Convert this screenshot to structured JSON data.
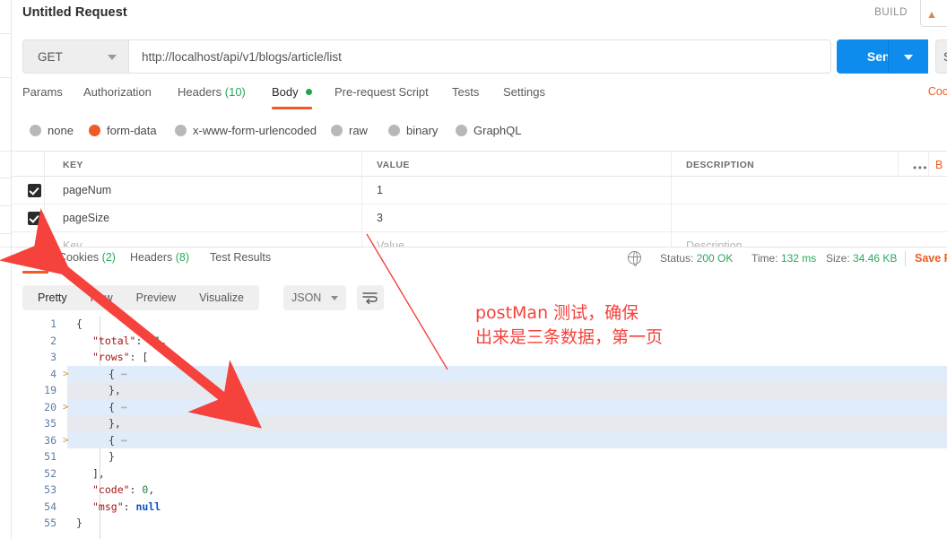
{
  "window": {
    "request_title": "Untitled Request",
    "build_label": "BUILD"
  },
  "url_bar": {
    "method": "GET",
    "url": "http://localhost/api/v1/blogs/article/list",
    "send_label": "Send",
    "save_label": "Sa"
  },
  "request_tabs": {
    "items": [
      {
        "label": "Params",
        "count": "",
        "active": false
      },
      {
        "label": "Authorization",
        "count": "",
        "active": false
      },
      {
        "label": "Headers",
        "count": "(10)",
        "active": false
      },
      {
        "label": "Body",
        "count": "",
        "active": true
      },
      {
        "label": "Pre-request Script",
        "count": "",
        "active": false
      },
      {
        "label": "Tests",
        "count": "",
        "active": false
      },
      {
        "label": "Settings",
        "count": "",
        "active": false
      }
    ],
    "cookies_link": "Cook"
  },
  "body_types": {
    "options": [
      {
        "label": "none",
        "selected": false
      },
      {
        "label": "form-data",
        "selected": true
      },
      {
        "label": "x-www-form-urlencoded",
        "selected": false
      },
      {
        "label": "raw",
        "selected": false
      },
      {
        "label": "binary",
        "selected": false
      },
      {
        "label": "GraphQL",
        "selected": false
      }
    ]
  },
  "kv_table": {
    "headers": {
      "key": "KEY",
      "value": "VALUE",
      "description": "DESCRIPTION"
    },
    "bulk_edit_label": "B",
    "rows": [
      {
        "checked": true,
        "key": "pageNum",
        "value": "1",
        "description": ""
      },
      {
        "checked": true,
        "key": "pageSize",
        "value": "3",
        "description": ""
      },
      {
        "checked": false,
        "key": "Key",
        "value": "Value",
        "description": "Description",
        "placeholder": true
      }
    ]
  },
  "response": {
    "tabs": [
      {
        "label": "Body",
        "count": "",
        "active": true
      },
      {
        "label": "Cookies",
        "count": "(2)",
        "active": false
      },
      {
        "label": "Headers",
        "count": "(8)",
        "active": false
      },
      {
        "label": "Test Results",
        "count": "",
        "active": false
      }
    ],
    "status_label": "Status:",
    "status_value": "200 OK",
    "time_label": "Time:",
    "time_value": "132 ms",
    "size_label": "Size:",
    "size_value": "34.46 KB",
    "save_response_label": "Save Res"
  },
  "viewer": {
    "modes": [
      {
        "label": "Pretty",
        "active": true
      },
      {
        "label": "Raw",
        "active": false
      },
      {
        "label": "Preview",
        "active": false
      },
      {
        "label": "Visualize",
        "active": false
      }
    ],
    "format": "JSON"
  },
  "json_body": {
    "lines": [
      {
        "no": "1",
        "fold": "",
        "indent": 0,
        "highlight": "none",
        "tokens": [
          {
            "t": "brace",
            "v": "{"
          }
        ]
      },
      {
        "no": "2",
        "fold": "",
        "indent": 1,
        "highlight": "none",
        "tokens": [
          {
            "t": "key",
            "v": "\"total\""
          },
          {
            "t": "plain",
            "v": ": "
          },
          {
            "t": "num",
            "v": "11"
          },
          {
            "t": "plain",
            "v": ","
          }
        ]
      },
      {
        "no": "3",
        "fold": "",
        "indent": 1,
        "highlight": "none",
        "tokens": [
          {
            "t": "key",
            "v": "\"rows\""
          },
          {
            "t": "plain",
            "v": ": ["
          }
        ]
      },
      {
        "no": "4",
        "fold": ">",
        "indent": 2,
        "highlight": "blue",
        "tokens": [
          {
            "t": "brace",
            "v": "{"
          },
          {
            "t": "dots",
            "v": " ⋯"
          }
        ]
      },
      {
        "no": "19",
        "fold": "",
        "indent": 2,
        "highlight": "grey",
        "tokens": [
          {
            "t": "brace",
            "v": "},"
          }
        ]
      },
      {
        "no": "20",
        "fold": ">",
        "indent": 2,
        "highlight": "blue",
        "tokens": [
          {
            "t": "brace",
            "v": "{"
          },
          {
            "t": "dots",
            "v": " ⋯"
          }
        ]
      },
      {
        "no": "35",
        "fold": "",
        "indent": 2,
        "highlight": "grey",
        "tokens": [
          {
            "t": "brace",
            "v": "},"
          }
        ]
      },
      {
        "no": "36",
        "fold": ">",
        "indent": 2,
        "highlight": "blue",
        "tokens": [
          {
            "t": "brace",
            "v": "{"
          },
          {
            "t": "dots",
            "v": " ⋯"
          }
        ]
      },
      {
        "no": "51",
        "fold": "",
        "indent": 2,
        "highlight": "none",
        "tokens": [
          {
            "t": "brace",
            "v": "}"
          }
        ]
      },
      {
        "no": "52",
        "fold": "",
        "indent": 1,
        "highlight": "none",
        "tokens": [
          {
            "t": "brace",
            "v": "],"
          }
        ]
      },
      {
        "no": "53",
        "fold": "",
        "indent": 1,
        "highlight": "none",
        "tokens": [
          {
            "t": "key",
            "v": "\"code\""
          },
          {
            "t": "plain",
            "v": ": "
          },
          {
            "t": "num",
            "v": "0"
          },
          {
            "t": "plain",
            "v": ","
          }
        ]
      },
      {
        "no": "54",
        "fold": "",
        "indent": 1,
        "highlight": "none",
        "tokens": [
          {
            "t": "key",
            "v": "\"msg\""
          },
          {
            "t": "plain",
            "v": ": "
          },
          {
            "t": "null",
            "v": "null"
          }
        ]
      },
      {
        "no": "55",
        "fold": "",
        "indent": 0,
        "highlight": "none",
        "tokens": [
          {
            "t": "brace",
            "v": "}"
          }
        ]
      }
    ]
  },
  "annotations": {
    "note_line1": "postMan 测试，确保",
    "note_line2": "出来是三条数据，第一页",
    "color": "#f5423c"
  }
}
